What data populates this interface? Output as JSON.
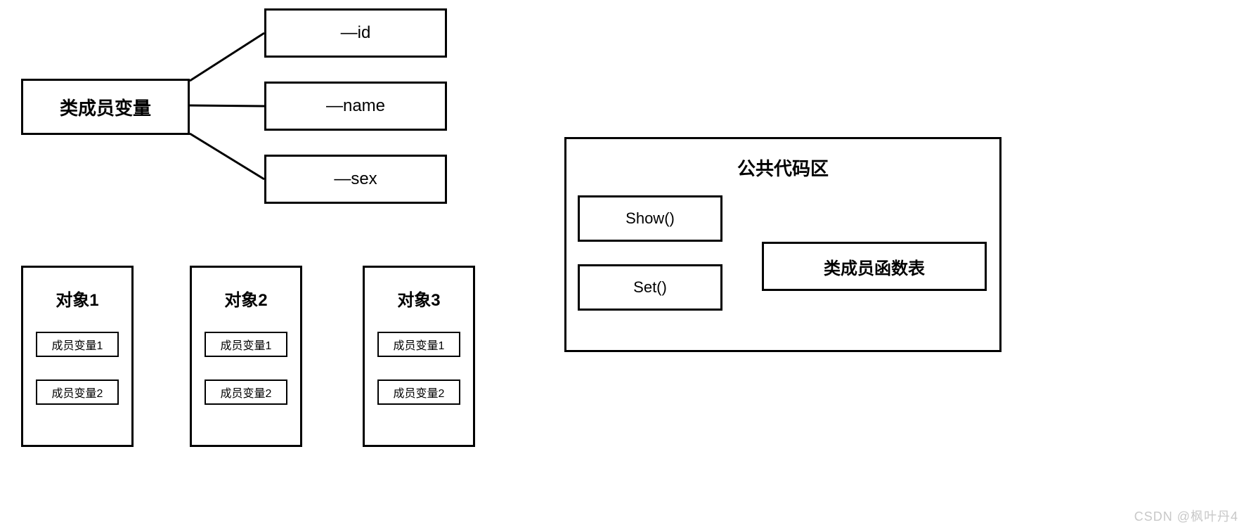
{
  "classMember": {
    "title": "类成员变量",
    "fields": [
      "—id",
      "—name",
      "—sex"
    ]
  },
  "objects": [
    {
      "title": "对象1",
      "members": [
        "成员变量1",
        "成员变量2"
      ]
    },
    {
      "title": "对象2",
      "members": [
        "成员变量1",
        "成员变量2"
      ]
    },
    {
      "title": "对象3",
      "members": [
        "成员变量1",
        "成员变量2"
      ]
    }
  ],
  "publicCode": {
    "title": "公共代码区",
    "functions": [
      "Show()",
      "Set()"
    ],
    "tableLabel": "类成员函数表"
  },
  "watermark": "CSDN @枫叶丹4"
}
